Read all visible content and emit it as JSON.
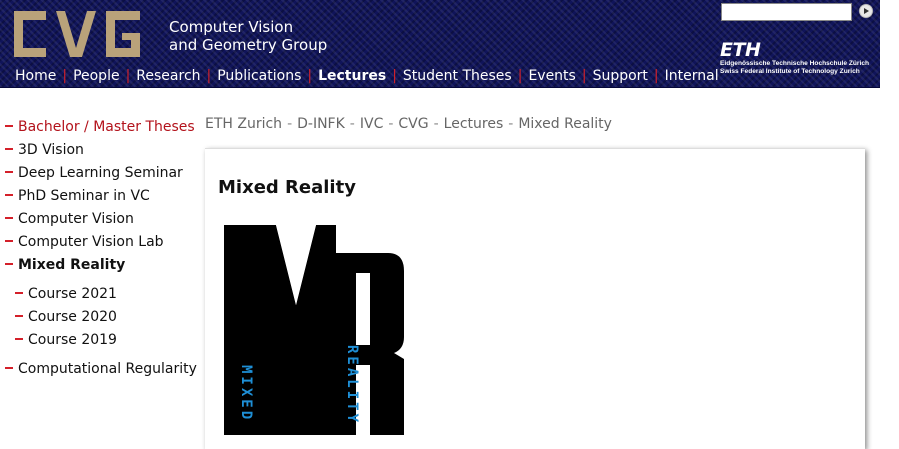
{
  "header": {
    "logo_text": "CVG",
    "group_name_line1": "Computer Vision",
    "group_name_line2": "and Geometry Group",
    "search": {
      "value": "",
      "placeholder": ""
    },
    "eth": {
      "wordmark": "ETH",
      "line1": "Eidgenössische Technische Hochschule Zürich",
      "line2": "Swiss Federal Institute of Technology Zurich"
    },
    "nav": [
      {
        "label": "Home",
        "active": false
      },
      {
        "label": "People",
        "active": false
      },
      {
        "label": "Research",
        "active": false
      },
      {
        "label": "Publications",
        "active": false
      },
      {
        "label": "Lectures",
        "active": true
      },
      {
        "label": "Student Theses",
        "active": false
      },
      {
        "label": "Events",
        "active": false
      },
      {
        "label": "Support",
        "active": false
      },
      {
        "label": "Internal",
        "active": false
      }
    ],
    "colors": {
      "background": "#10145a",
      "logo_gold": "#b9a27a",
      "separator": "#d4202a"
    }
  },
  "breadcrumb": [
    "ETH Zurich",
    "D-INFK",
    "IVC",
    "CVG",
    "Lectures",
    "Mixed Reality"
  ],
  "sidebar": {
    "items": [
      {
        "label": "Bachelor / Master Theses"
      },
      {
        "label": "3D Vision"
      },
      {
        "label": "Deep Learning Seminar"
      },
      {
        "label": "PhD Seminar in VC"
      },
      {
        "label": "Computer Vision"
      },
      {
        "label": "Computer Vision Lab"
      },
      {
        "label": "Mixed Reality"
      },
      {
        "label": "Course 2021"
      },
      {
        "label": "Course 2020"
      },
      {
        "label": "Course 2019"
      },
      {
        "label": "Computational Regularity"
      }
    ]
  },
  "main": {
    "title": "Mixed Reality",
    "logo": {
      "big_letters": "MR",
      "word_left": "MIXED",
      "word_right": "REALITY",
      "accent": "#1e8fd6"
    }
  }
}
